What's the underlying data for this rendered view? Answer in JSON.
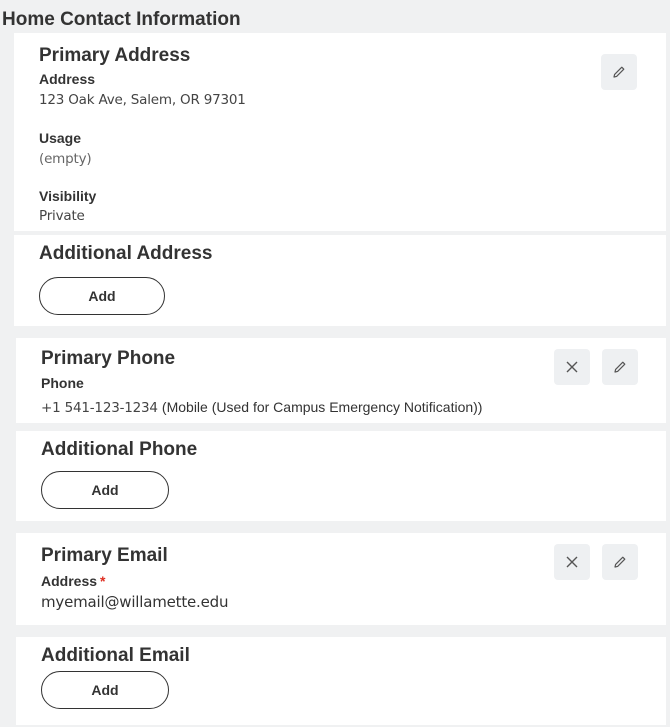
{
  "page": {
    "title": "Home Contact Information"
  },
  "primary_address": {
    "title": "Primary Address",
    "address_label": "Address",
    "address_value": "123 Oak Ave, Salem, OR 97301",
    "usage_label": "Usage",
    "usage_value": "(empty)",
    "visibility_label": "Visibility",
    "visibility_value": "Private"
  },
  "additional_address": {
    "title": "Additional Address",
    "add_label": "Add"
  },
  "primary_phone": {
    "title": "Primary Phone",
    "phone_label": "Phone",
    "phone_value": "+1 541-123-1234",
    "phone_type": "(Mobile (Used for Campus Emergency Notification))"
  },
  "additional_phone": {
    "title": "Additional Phone",
    "add_label": "Add"
  },
  "primary_email": {
    "title": "Primary Email",
    "address_label": "Address",
    "required_marker": "*",
    "email_value": "myemail@willamette.edu"
  },
  "additional_email": {
    "title": "Additional Email",
    "add_label": "Add"
  },
  "icons": {
    "edit": "pencil-icon",
    "delete": "close-icon"
  },
  "colors": {
    "required": "#de2e21",
    "card": "#ffffff",
    "background": "#f0f1f2"
  }
}
